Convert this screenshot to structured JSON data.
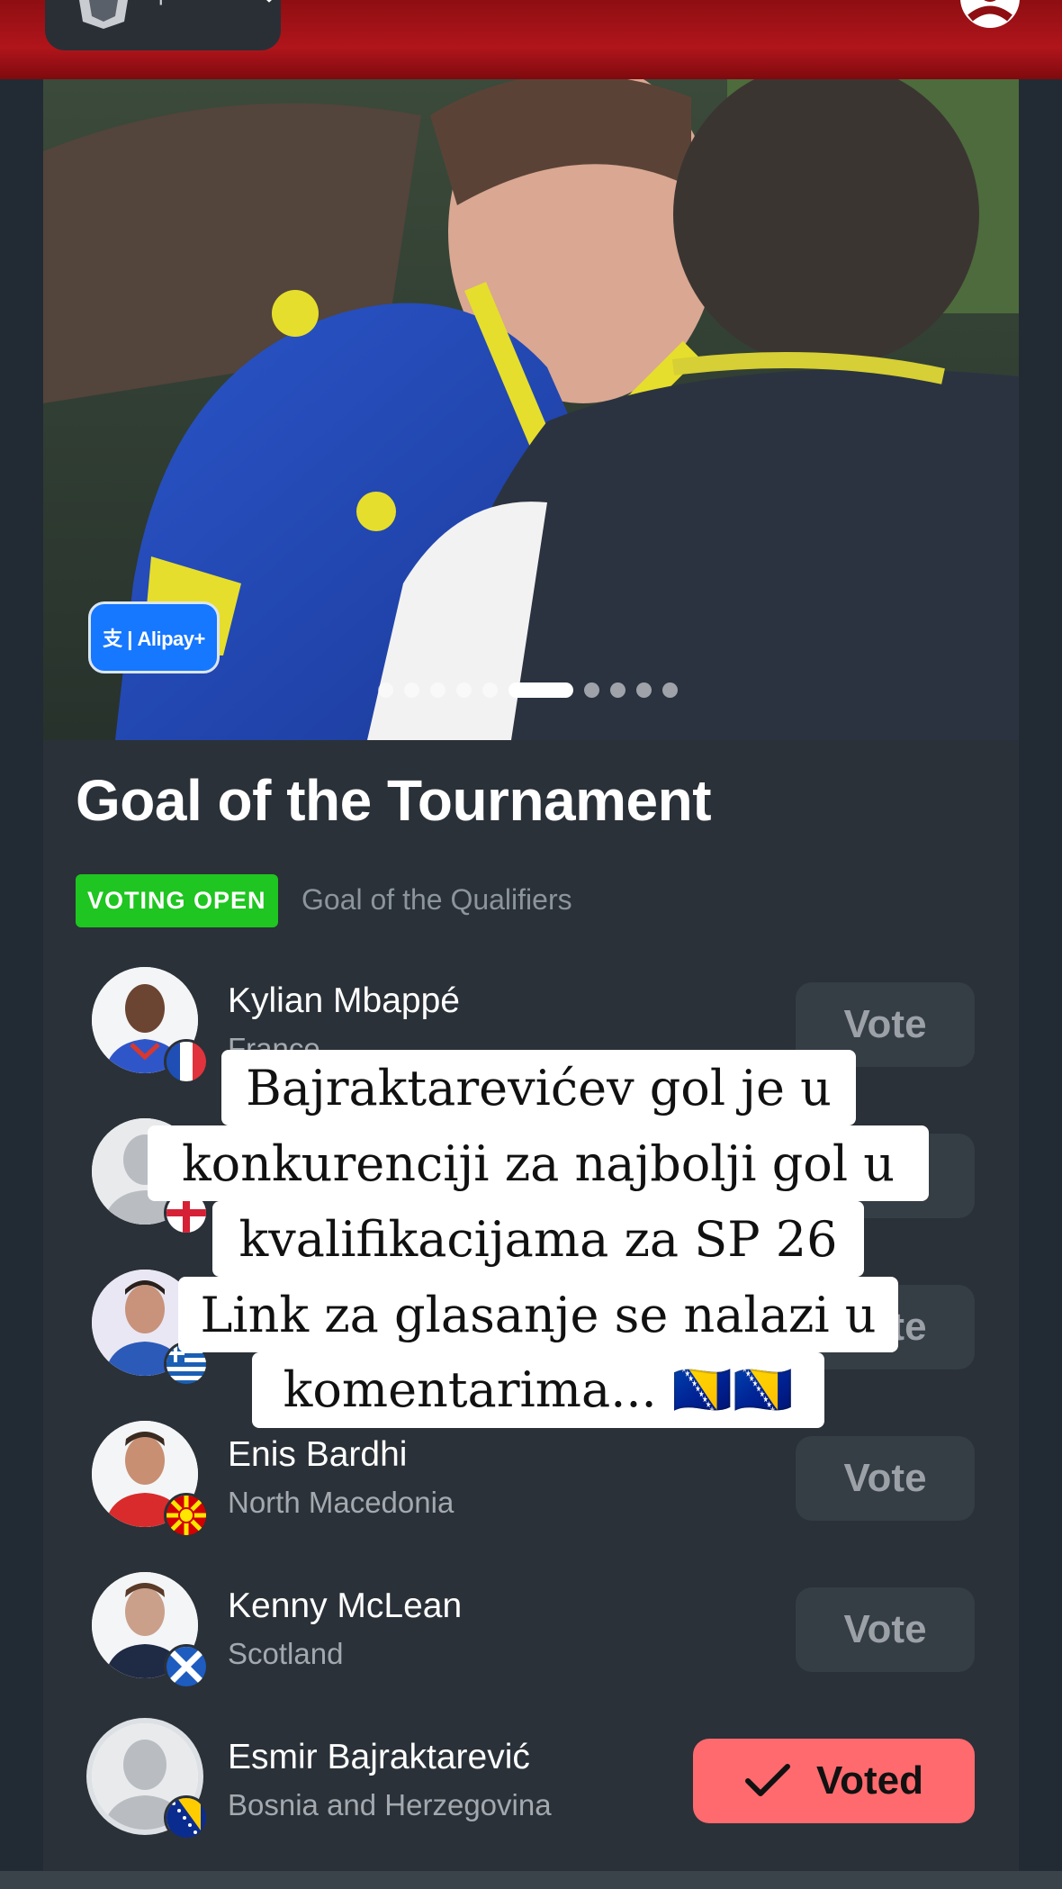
{
  "hero": {
    "sponsor": "支 | Alipay+",
    "slide_count": 11,
    "active_slide": 6
  },
  "card": {
    "title": "Goal of the Tournament",
    "status_badge": "VOTING OPEN",
    "subtitle": "Goal of the Qualifiers"
  },
  "nominees": [
    {
      "name": "Kylian Mbappé",
      "country": "France",
      "button": "Vote",
      "flag": "france-flag"
    },
    {
      "name": "",
      "country": "",
      "button": "Vote",
      "flag": "england-flag"
    },
    {
      "name": "",
      "country": "",
      "button": "Vote",
      "flag": "greece-flag"
    },
    {
      "name": "Enis Bardhi",
      "country": "North Macedonia",
      "button": "Vote",
      "flag": "north-macedonia-flag"
    },
    {
      "name": "Kenny McLean",
      "country": "Scotland",
      "button": "Vote",
      "flag": "scotland-flag"
    },
    {
      "name": "Esmir Bajraktarević",
      "country": "Bosnia and Herzegovina",
      "button": "Voted",
      "flag": "bosnia-flag"
    }
  ],
  "overlay": {
    "lines": [
      "Bajraktarevićev gol je u",
      "konkurenciji za najbolji gol u",
      "kvalifikacijama za SP 26",
      "Link za glasanje se nalazi u",
      "komentarima... 🇧🇦🇧🇦"
    ]
  },
  "colors": {
    "header_red": "#b0151b",
    "voting_open": "#1fc520",
    "voted_button": "#ff6a6e",
    "vote_button": "#353d45",
    "sponsor_blue": "#1677ff"
  }
}
